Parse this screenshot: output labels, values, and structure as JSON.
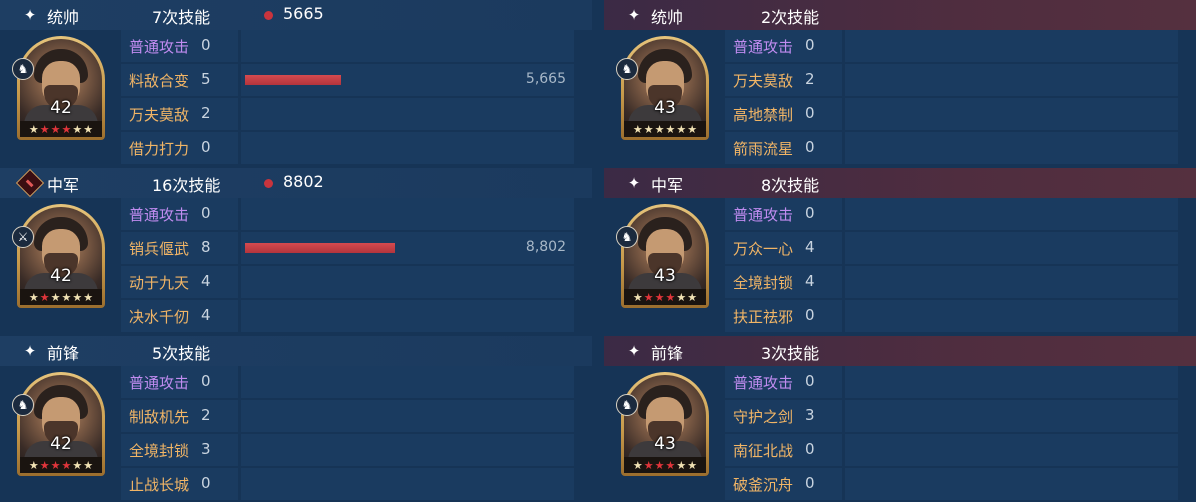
{
  "left": [
    {
      "role": "统帅",
      "role_icon": "sparkle-icon",
      "skill_count": "7次技能",
      "damage_total": "5665",
      "level": "42",
      "stars": [
        false,
        true,
        true,
        true,
        false,
        false
      ],
      "troop_icon": "cavalry-icon",
      "skills": [
        {
          "name": "普通攻击",
          "count": "0",
          "basic": true
        },
        {
          "name": "料敌合变",
          "count": "5",
          "damage": "5,665",
          "bar_fraction": 0.64
        },
        {
          "name": "万夫莫敌",
          "count": "2"
        },
        {
          "name": "借力打力",
          "count": "0"
        }
      ]
    },
    {
      "role": "中军",
      "role_icon": "banner-icon",
      "skill_count": "16次技能",
      "damage_total": "8802",
      "level": "42",
      "stars": [
        false,
        true,
        false,
        false,
        false,
        false
      ],
      "troop_icon": "spear-icon",
      "skills": [
        {
          "name": "普通攻击",
          "count": "0",
          "basic": true
        },
        {
          "name": "销兵偃武",
          "count": "8",
          "damage": "8,802",
          "bar_fraction": 1.0
        },
        {
          "name": "动于九天",
          "count": "4"
        },
        {
          "name": "决水千仞",
          "count": "4"
        }
      ]
    },
    {
      "role": "前锋",
      "role_icon": "sparkle-icon",
      "skill_count": "5次技能",
      "damage_total": "",
      "level": "42",
      "stars": [
        false,
        true,
        true,
        true,
        false,
        false
      ],
      "troop_icon": "cavalry-icon",
      "skills": [
        {
          "name": "普通攻击",
          "count": "0",
          "basic": true
        },
        {
          "name": "制敌机先",
          "count": "2"
        },
        {
          "name": "全境封锁",
          "count": "3"
        },
        {
          "name": "止战长城",
          "count": "0"
        }
      ]
    }
  ],
  "right": [
    {
      "role": "统帅",
      "role_icon": "sparkle-icon",
      "skill_count": "2次技能",
      "damage_total": "",
      "level": "43",
      "stars": [
        false,
        false,
        false,
        false,
        false,
        false
      ],
      "troop_icon": "cavalry-icon",
      "skills": [
        {
          "name": "普通攻击",
          "count": "0",
          "basic": true
        },
        {
          "name": "万夫莫敌",
          "count": "2"
        },
        {
          "name": "高地禁制",
          "count": "0"
        },
        {
          "name": "箭雨流星",
          "count": "0"
        }
      ]
    },
    {
      "role": "中军",
      "role_icon": "sparkle-icon",
      "skill_count": "8次技能",
      "damage_total": "",
      "level": "43",
      "stars": [
        false,
        true,
        true,
        true,
        false,
        false
      ],
      "troop_icon": "cavalry-icon",
      "skills": [
        {
          "name": "普通攻击",
          "count": "0",
          "basic": true
        },
        {
          "name": "万众一心",
          "count": "4"
        },
        {
          "name": "全境封锁",
          "count": "4"
        },
        {
          "name": "扶正祛邪",
          "count": "0"
        }
      ]
    },
    {
      "role": "前锋",
      "role_icon": "sparkle-icon",
      "skill_count": "3次技能",
      "damage_total": "",
      "level": "43",
      "stars": [
        false,
        true,
        true,
        true,
        false,
        false
      ],
      "troop_icon": "cavalry-icon",
      "skills": [
        {
          "name": "普通攻击",
          "count": "0",
          "basic": true
        },
        {
          "name": "守护之剑",
          "count": "3"
        },
        {
          "name": "南征北战",
          "count": "0"
        },
        {
          "name": "破釜沉舟",
          "count": "0"
        }
      ]
    }
  ]
}
